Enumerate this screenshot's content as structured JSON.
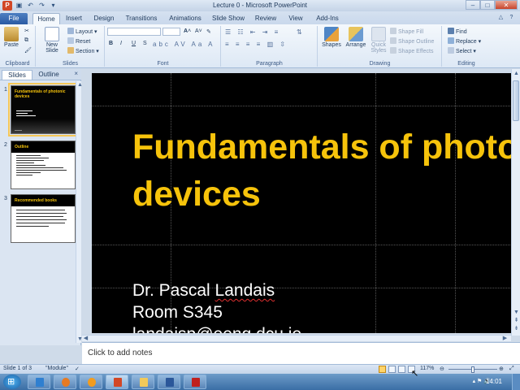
{
  "window": {
    "title": "Lecture 0 - Microsoft PowerPoint",
    "app_icon": "P",
    "qat_icons": [
      "save-icon",
      "undo-icon",
      "redo-icon",
      "customize-icon"
    ],
    "controls": [
      "–",
      "□",
      "✕"
    ]
  },
  "tabs": [
    "File",
    "Home",
    "Insert",
    "Design",
    "Transitions",
    "Animations",
    "Slide Show",
    "Review",
    "View",
    "Add-Ins"
  ],
  "active_tab": "Home",
  "ribbon": {
    "clipboard": {
      "paste": "Paste",
      "label": "Clipboard"
    },
    "slides": {
      "new_slide": "New Slide",
      "layout": "Layout",
      "reset": "Reset",
      "section": "Section",
      "label": "Slides"
    },
    "font": {
      "label": "Font",
      "bold": "B",
      "italic": "I",
      "underline": "U",
      "strike": "S",
      "size_up": "A",
      "size_down": "A"
    },
    "paragraph": {
      "label": "Paragraph"
    },
    "drawing": {
      "shapes": "Shapes",
      "arrange": "Arrange",
      "quick_styles": "Quick Styles",
      "shape_fill": "Shape Fill",
      "shape_outline": "Shape Outline",
      "shape_effects": "Shape Effects",
      "label": "Drawing"
    },
    "editing": {
      "find": "Find",
      "replace": "Replace",
      "select": "Select",
      "label": "Editing"
    }
  },
  "left_pane": {
    "tabs": [
      "Slides",
      "Outline"
    ],
    "close": "×",
    "slides": [
      {
        "num": "1",
        "title": "Fundamentals of photonic devices"
      },
      {
        "num": "2",
        "title": "Outline"
      },
      {
        "num": "3",
        "title": "Recommended books"
      }
    ]
  },
  "slide": {
    "title_line1": "Fundamentals of photonic",
    "title_line2": "devices",
    "body_line1_pre": "Dr. Pascal ",
    "body_line1_err": "Landais",
    "body_line2": "Room S345",
    "body_line3": "landaisp@eeng.dcu.ie"
  },
  "notes_placeholder": "Click to add notes",
  "status": {
    "slide": "Slide 1 of 3",
    "theme": "\"Module\"",
    "zoom": "117%"
  },
  "taskbar": {
    "time": "14:01",
    "apps": [
      "explorer",
      "firefox",
      "media-player",
      "powerpoint",
      "folder",
      "word",
      "acrobat"
    ]
  }
}
